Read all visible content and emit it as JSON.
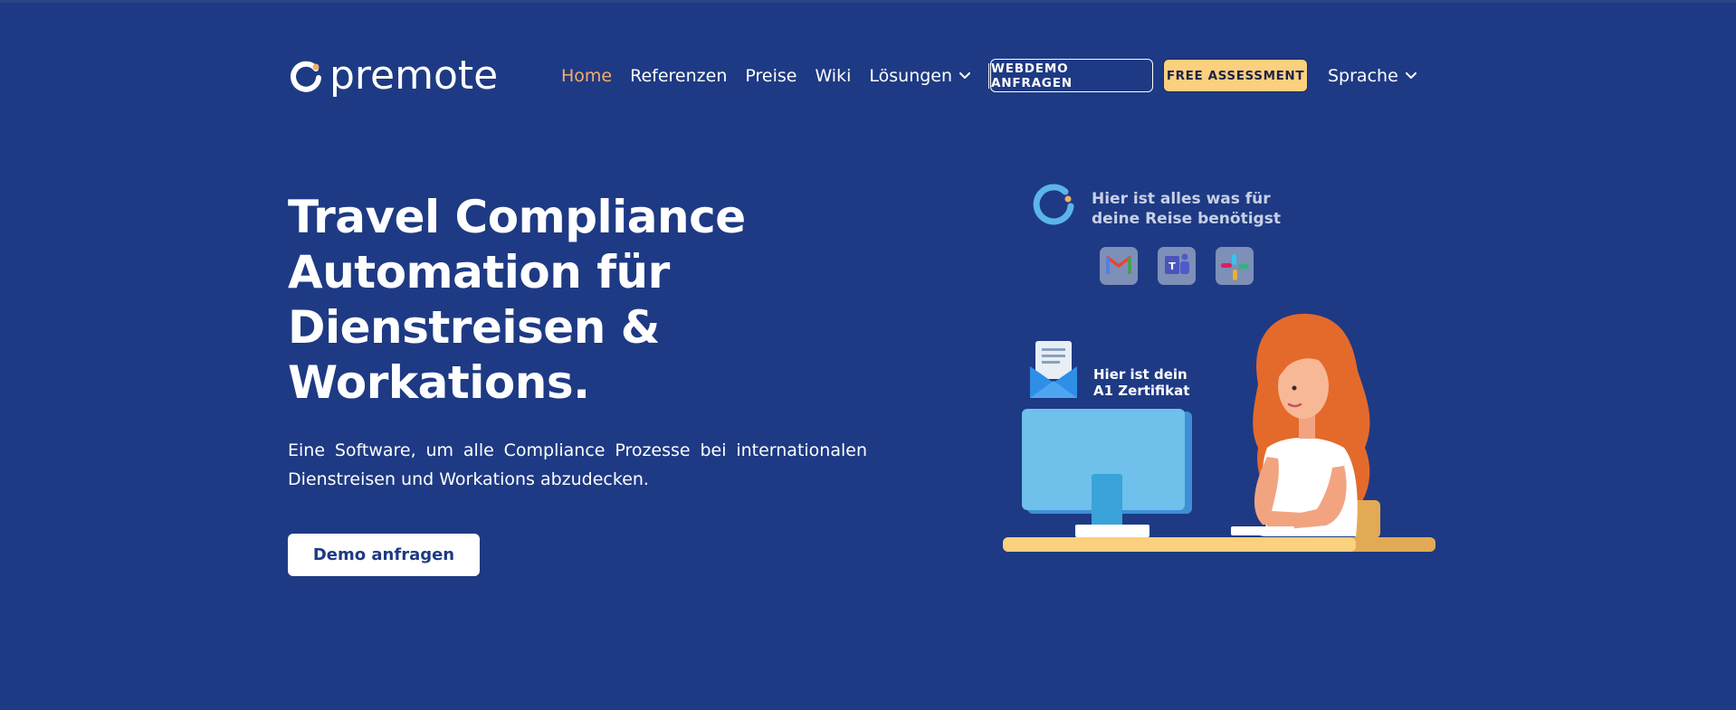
{
  "brand": {
    "name": "premote"
  },
  "nav": {
    "items": [
      {
        "label": "Home",
        "active": true
      },
      {
        "label": "Referenzen"
      },
      {
        "label": "Preise"
      },
      {
        "label": "Wiki"
      }
    ],
    "dropdown_label": "Lösungen",
    "webdemo_label": "WEBDEMO ANFRAGEN",
    "assessment_label": "FREE ASSESSMENT",
    "language_label": "Sprache"
  },
  "hero": {
    "title_lines": [
      "Travel Compliance",
      "Automation für",
      "Dienstreisen &",
      "Workations."
    ],
    "subtitle": "Eine Software, um alle Compliance Prozesse bei internationalen Dienstreisen und Workations abzudecken.",
    "cta_label": "Demo anfragen"
  },
  "illustration": {
    "bubble_lines": [
      "Hier ist alles was für",
      "deine Reise benötigst"
    ],
    "cert_lines": [
      "Hier ist dein",
      "A1 Zertifikat"
    ],
    "app_icons": [
      "gmail-icon",
      "teams-icon",
      "slack-icon"
    ]
  },
  "colors": {
    "background": "#1e3a84",
    "nav_active": "#f6ad6b",
    "accent_yellow": "#fbd07f",
    "white": "#ffffff"
  }
}
